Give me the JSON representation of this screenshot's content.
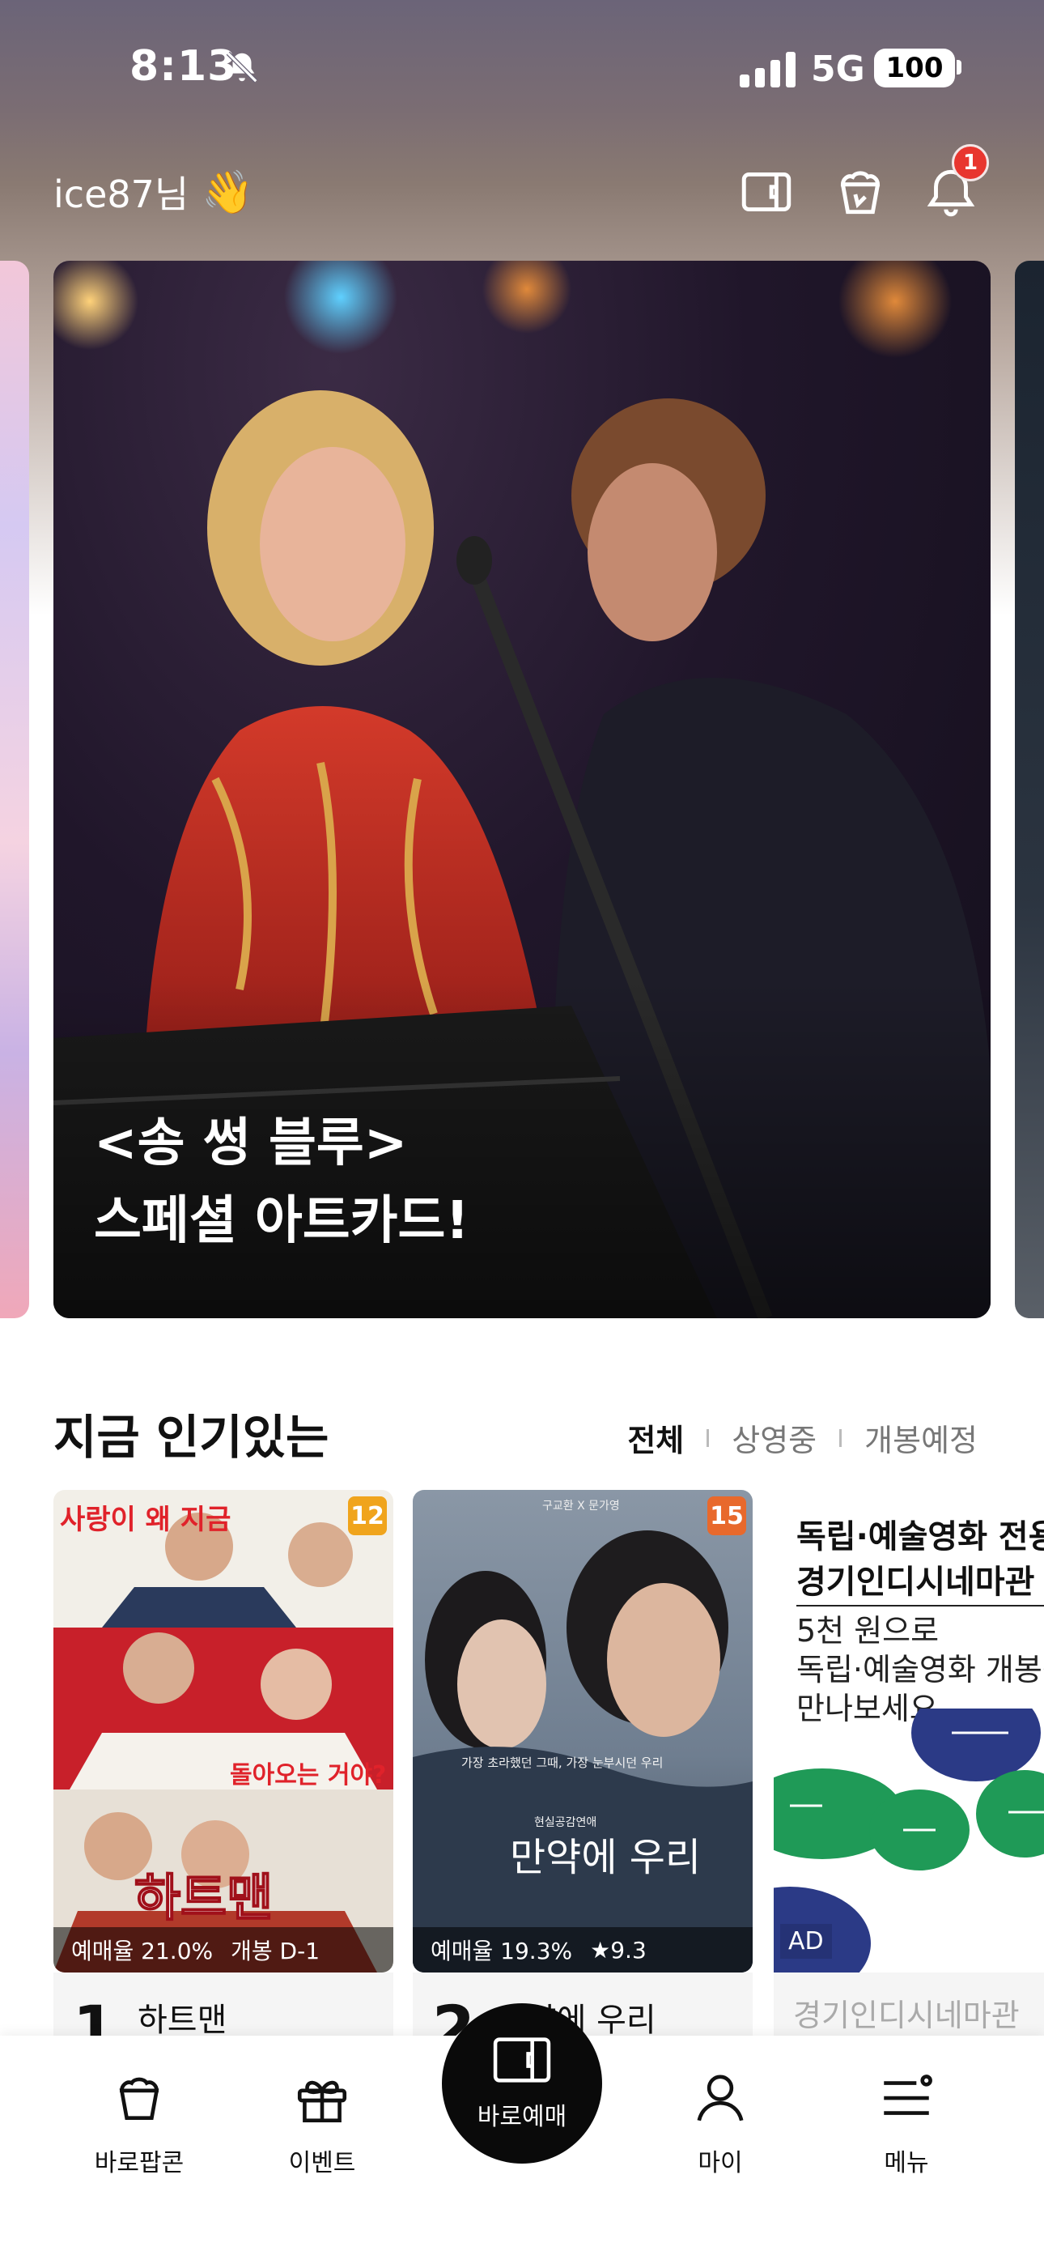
{
  "status_bar": {
    "time": "8:13",
    "network": "5G",
    "battery": "100"
  },
  "header": {
    "greeting": "ice87님",
    "greeting_emoji": "👋",
    "notification_count": "1"
  },
  "banner": {
    "line1": "<송 썽 블루>",
    "line2": "스페셜 아트카드!"
  },
  "popular": {
    "title": "지금 인기있는",
    "filters": [
      "전체",
      "상영중",
      "개봉예정"
    ],
    "active_filter": "전체"
  },
  "movies": [
    {
      "rank": "1",
      "title": "하트맨",
      "age": "12",
      "age_color": "#f0a41c",
      "booking_rate": "예매율 21.0%",
      "extra": "개봉 D-1",
      "poster_text": {
        "top": "사랑이 왜 지금",
        "mid": "돌아오는 거야?",
        "logo": "하트맨"
      }
    },
    {
      "rank": "2",
      "title": "만약에 우리",
      "age": "15",
      "age_color": "#e8692c",
      "booking_rate": "예매율 19.3%",
      "extra": "★9.3",
      "poster_text": {
        "credit": "구교환 X 문가영",
        "tagline": "가장 초라했던 그때, 가장 눈부시던 우리",
        "sub": "현실공감연애",
        "logo": "만약에 우리"
      }
    }
  ],
  "ad": {
    "title_line1": "독립·예술영화 전용",
    "title_line2": "경기인디시네마관",
    "desc_line1": "5천 원으로",
    "desc_line2": "독립·예술영화 개봉작",
    "desc_line3": "만나보세요.",
    "label": "AD",
    "caption": "경기인디시네마관"
  },
  "tabbar": {
    "popcorn": "바로팝콘",
    "event": "이벤트",
    "booking": "바로예매",
    "my": "마이",
    "menu": "메뉴"
  },
  "colors": {
    "accent_red": "#e8362f",
    "ad_green": "#1f9a57",
    "ad_navy": "#2b3a86"
  }
}
